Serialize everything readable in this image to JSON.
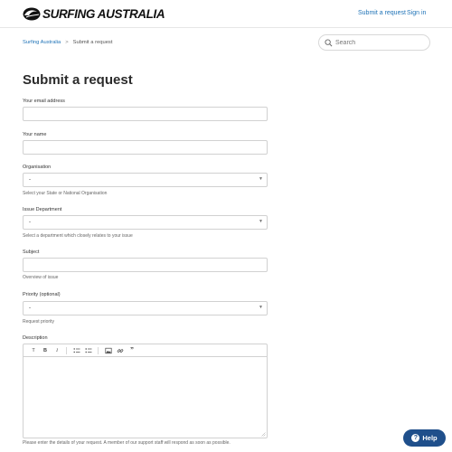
{
  "header": {
    "logo_text": "SURFING AUSTRALIA",
    "nav": {
      "submit_request": "Submit a request",
      "sign_in": "Sign in"
    }
  },
  "breadcrumb": {
    "home": "Surfing Australia",
    "separator": ">",
    "current": "Submit a request"
  },
  "search": {
    "placeholder": "Search"
  },
  "page_title": "Submit a request",
  "form": {
    "email": {
      "label": "Your email address",
      "value": ""
    },
    "name": {
      "label": "Your name",
      "value": ""
    },
    "organisation": {
      "label": "Organisation",
      "value": "-",
      "hint": "Select your State or National Organisation"
    },
    "issue_department": {
      "label": "Issue Department",
      "value": "-",
      "hint": "Select a department which closely relates to your issue"
    },
    "subject": {
      "label": "Subject",
      "value": "",
      "hint": "Overview of issue"
    },
    "priority": {
      "label": "Priority (optional)",
      "value": "-",
      "hint": "Request priority"
    },
    "description": {
      "label": "Description",
      "value": "",
      "hint": "Please enter the details of your request. A member of our support staff will respond as soon as possible."
    }
  },
  "editor_toolbar": {
    "text_style": "T",
    "bold": "B",
    "italic": "I",
    "quote": "”"
  },
  "help_button": {
    "label": "Help"
  },
  "colors": {
    "link": "#1f73b7",
    "help_button": "#1f4f8b",
    "border": "#d1d1d1"
  }
}
